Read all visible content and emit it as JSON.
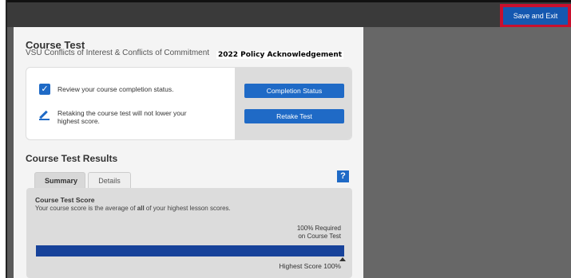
{
  "header": {
    "save_exit_label": "Save and Exit"
  },
  "course": {
    "title": "Course Test",
    "subtitle": "VSU Conflicts of Interest & Conflicts of Commitment",
    "subtitle_bold": "2022 Policy Acknowledgement"
  },
  "status_card": {
    "row1_text": "Review your course completion status.",
    "row2_text": "Retaking the course test will not lower your highest score.",
    "completion_button": "Completion Status",
    "retake_button": "Retake Test"
  },
  "results": {
    "title": "Course Test Results",
    "tabs": [
      {
        "label": "Summary"
      },
      {
        "label": "Details"
      }
    ],
    "help_label": "?",
    "score_title": "Course Test Score",
    "score_desc_pre": "Your course score is the average of ",
    "score_desc_bold": "all",
    "score_desc_post": " of your highest lesson scores.",
    "required_line1": "100% Required",
    "required_line2": "on Course Test",
    "highest_label": "Highest Score 100%",
    "progress_percent": 100
  },
  "colors": {
    "accent": "#1f6ac6",
    "bar": "#17429a",
    "highlight": "#c8102e"
  },
  "icons": {
    "check": "checkmark-icon",
    "edit": "pencil-icon",
    "help": "help-icon"
  }
}
